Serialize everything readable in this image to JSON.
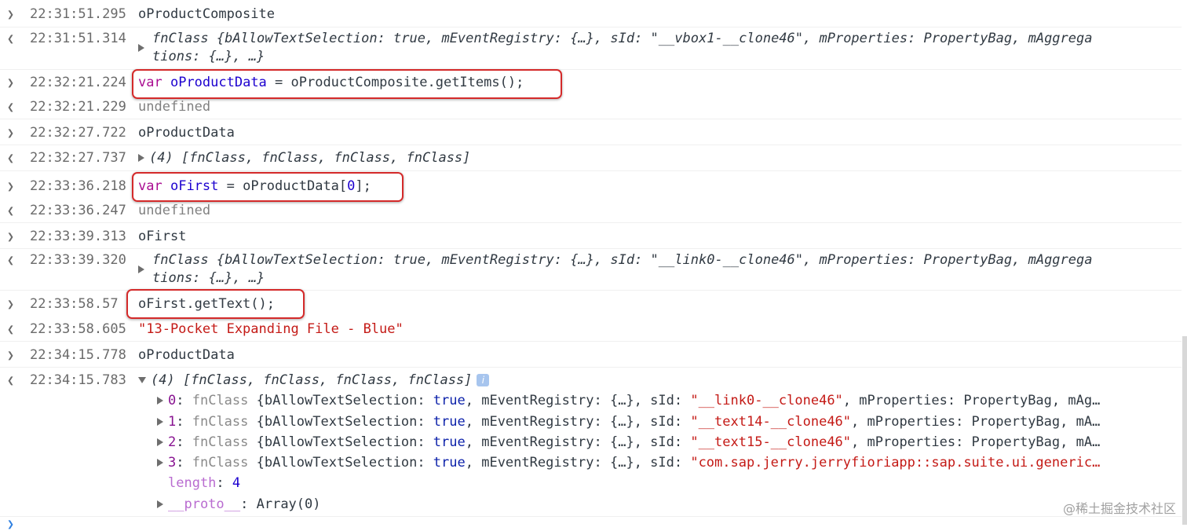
{
  "entries": [
    {
      "ts": "22:31:51.295",
      "text": "oProductComposite"
    },
    {
      "ts": "22:31:51.314",
      "line1": "fnClass {bAllowTextSelection: true, mEventRegistry: {…}, sId: \"__vbox1-__clone46\", mProperties: PropertyBag, mAggrega",
      "line2": "tions: {…}, …}"
    },
    {
      "ts": "22:32:21.224",
      "kw": "var",
      "var": "oProductData",
      "rest": " = oProductComposite.getItems();"
    },
    {
      "ts": "22:32:21.229",
      "text": "undefined"
    },
    {
      "ts": "22:32:27.722",
      "text": "oProductData"
    },
    {
      "ts": "22:32:27.737",
      "text": "(4) [fnClass, fnClass, fnClass, fnClass]"
    },
    {
      "ts": "22:33:36.218",
      "kw": "var",
      "var": "oFirst",
      "rest_a": " = oProductData[",
      "num": "0",
      "rest_b": "];"
    },
    {
      "ts": "22:33:36.247",
      "text": "undefined"
    },
    {
      "ts": "22:33:39.313",
      "text": "oFirst"
    },
    {
      "ts": "22:33:39.320",
      "line1": "fnClass {bAllowTextSelection: true, mEventRegistry: {…}, sId: \"__link0-__clone46\", mProperties: PropertyBag, mAggrega",
      "line2": "tions: {…}, …}"
    },
    {
      "ts": "22:33:58.57",
      "text": "oFirst.getText();"
    },
    {
      "ts": "22:33:58.605",
      "text": "\"13-Pocket Expanding File - Blue\""
    },
    {
      "ts": "22:34:15.778",
      "text": "oProductData"
    },
    {
      "ts": "22:34:15.783",
      "text": "(4) [fnClass, fnClass, fnClass, fnClass]"
    }
  ],
  "array_items": [
    {
      "idx": "0",
      "cls": "fnClass",
      "a": " {bAllowTextSelection: ",
      "t": "true",
      "b": ", mEventRegistry: {…}, sId: ",
      "s": "\"__link0-__clone46\"",
      "c": ", mProperties: PropertyBag, mAg…"
    },
    {
      "idx": "1",
      "cls": "fnClass",
      "a": " {bAllowTextSelection: ",
      "t": "true",
      "b": ", mEventRegistry: {…}, sId: ",
      "s": "\"__text14-__clone46\"",
      "c": ", mProperties: PropertyBag, mA…"
    },
    {
      "idx": "2",
      "cls": "fnClass",
      "a": " {bAllowTextSelection: ",
      "t": "true",
      "b": ", mEventRegistry: {…}, sId: ",
      "s": "\"__text15-__clone46\"",
      "c": ", mProperties: PropertyBag, mA…"
    },
    {
      "idx": "3",
      "cls": "fnClass",
      "a": " {bAllowTextSelection: ",
      "t": "true",
      "b": ", mEventRegistry: {…}, sId: ",
      "s": "\"com.sap.jerry.jerryfioriapp::sap.suite.ui.generic…",
      "c": ""
    }
  ],
  "length_label": "length",
  "length_value": "4",
  "proto_label": "__proto__",
  "proto_value": "Array(0)",
  "info_icon": "i",
  "watermark": "@稀土掘金技术社区",
  "icons": {
    "in_arrow": "›",
    "out_arrow": "‹",
    "expand": "triangle-right",
    "collapse": "triangle-down"
  }
}
